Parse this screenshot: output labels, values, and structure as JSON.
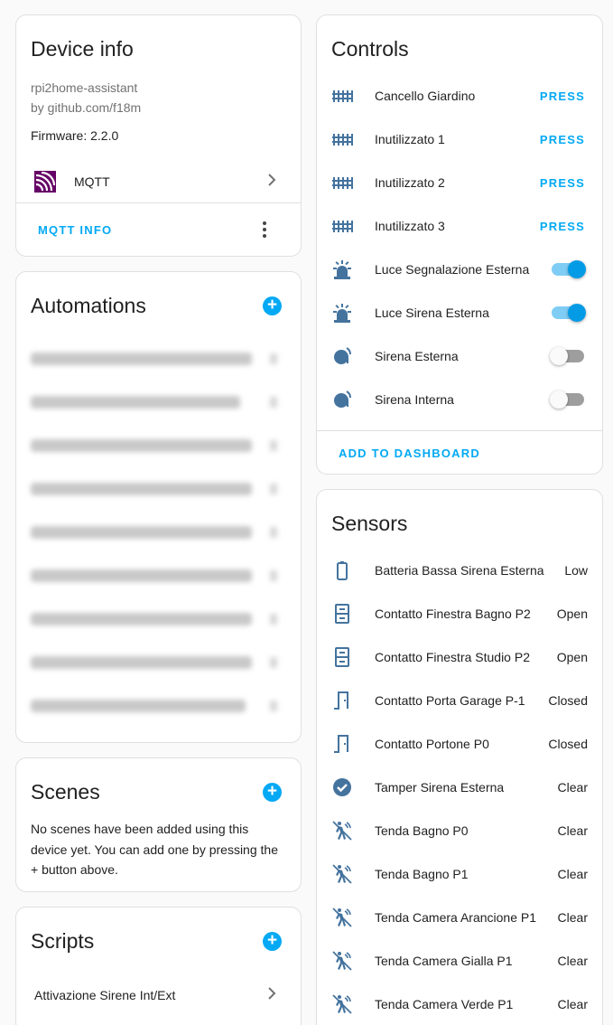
{
  "device_info": {
    "title": "Device info",
    "model": "rpi2home-assistant",
    "by": "by github.com/f18m",
    "firmware": "Firmware: 2.2.0",
    "integration": "MQTT",
    "info_button": "MQTT INFO"
  },
  "automations": {
    "title": "Automations",
    "items": [
      "",
      "",
      "",
      "",
      "",
      "",
      "",
      "",
      ""
    ]
  },
  "scenes": {
    "title": "Scenes",
    "empty_text": "No scenes have been added using this device yet. You can add one by pressing the + button above."
  },
  "scripts": {
    "title": "Scripts",
    "items": [
      "Attivazione Sirene Int/Ext"
    ]
  },
  "controls": {
    "title": "Controls",
    "buttons": [
      {
        "label": "Cancello Giardino",
        "action": "PRESS"
      },
      {
        "label": "Inutilizzato 1",
        "action": "PRESS"
      },
      {
        "label": "Inutilizzato 2",
        "action": "PRESS"
      },
      {
        "label": "Inutilizzato 3",
        "action": "PRESS"
      }
    ],
    "switches": [
      {
        "label": "Luce Segnalazione Esterna",
        "state": "on",
        "icon": "alarm-light-icon"
      },
      {
        "label": "Luce Sirena Esterna",
        "state": "on",
        "icon": "alarm-light-icon"
      },
      {
        "label": "Sirena Esterna",
        "state": "off",
        "icon": "bell-icon"
      },
      {
        "label": "Sirena Interna",
        "state": "off",
        "icon": "bell-icon"
      }
    ],
    "add_to_dashboard": "ADD TO DASHBOARD"
  },
  "sensors": {
    "title": "Sensors",
    "items": [
      {
        "label": "Batteria Bassa Sirena Esterna",
        "value": "Low",
        "icon": "battery-icon"
      },
      {
        "label": "Contatto Finestra Bagno P2",
        "value": "Open",
        "icon": "window-icon"
      },
      {
        "label": "Contatto Finestra Studio P2",
        "value": "Open",
        "icon": "window-icon"
      },
      {
        "label": "Contatto Porta Garage P-1",
        "value": "Closed",
        "icon": "door-icon"
      },
      {
        "label": "Contatto Portone P0",
        "value": "Closed",
        "icon": "door-icon"
      },
      {
        "label": "Tamper Sirena Esterna",
        "value": "Clear",
        "icon": "check-circle-icon"
      },
      {
        "label": "Tenda Bagno P0",
        "value": "Clear",
        "icon": "motion-off-icon"
      },
      {
        "label": "Tenda Bagno P1",
        "value": "Clear",
        "icon": "motion-off-icon"
      },
      {
        "label": "Tenda Camera Arancione P1",
        "value": "Clear",
        "icon": "motion-off-icon"
      },
      {
        "label": "Tenda Camera Gialla P1",
        "value": "Clear",
        "icon": "motion-off-icon"
      },
      {
        "label": "Tenda Camera Verde P1",
        "value": "Clear",
        "icon": "motion-off-icon"
      }
    ]
  },
  "colors": {
    "accent": "#03a9f4",
    "icon": "#44739e",
    "mqtt": "#660066"
  }
}
